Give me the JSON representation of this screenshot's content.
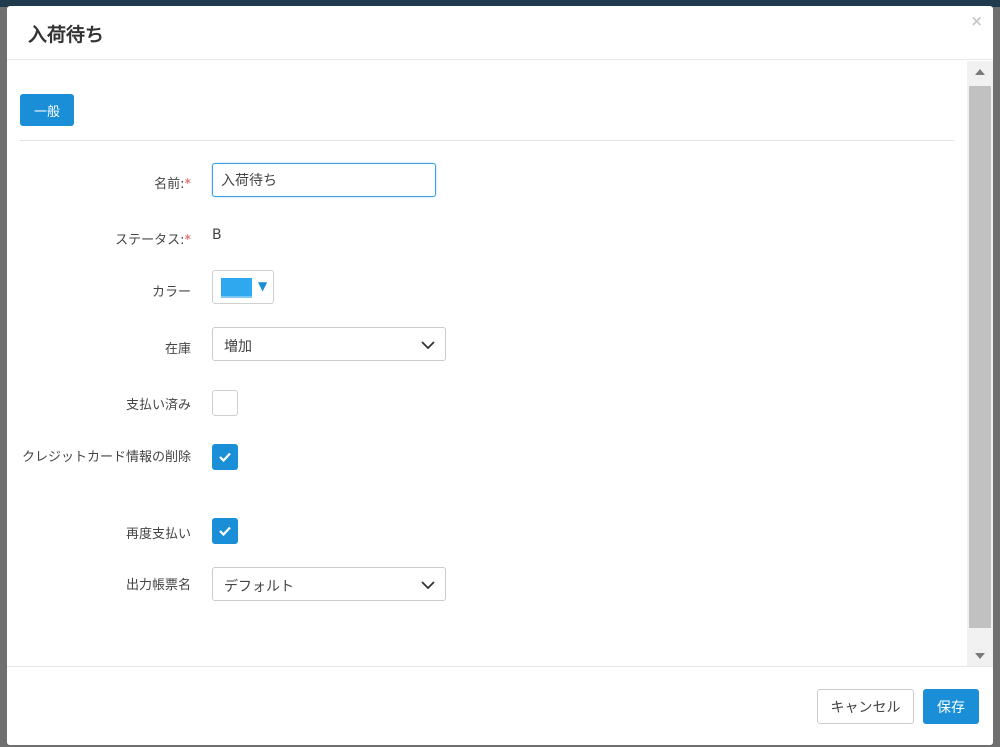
{
  "dialog": {
    "title": "入荷待ち",
    "close_glyph": "×"
  },
  "tabs": [
    {
      "label": "一般",
      "active": true
    }
  ],
  "form": {
    "name": {
      "label": "名前:",
      "required_mark": "*",
      "value": "入荷待ち"
    },
    "status": {
      "label": "ステータス:",
      "required_mark": "*",
      "value": "B"
    },
    "color": {
      "label": "カラー",
      "value": "#2fa8ef",
      "caret": "▼"
    },
    "stock": {
      "label": "在庫",
      "selected": "増加"
    },
    "paid": {
      "label": "支払い済み",
      "checked": false
    },
    "delete_card": {
      "label": "クレジットカード情報の削除",
      "checked": true
    },
    "repay": {
      "label": "再度支払い",
      "checked": true
    },
    "output_form": {
      "label": "出力帳票名",
      "selected": "デフォルト"
    }
  },
  "footer": {
    "cancel_label": "キャンセル",
    "save_label": "保存"
  },
  "colors": {
    "accent": "#1a8fd8",
    "required": "#e05252"
  }
}
